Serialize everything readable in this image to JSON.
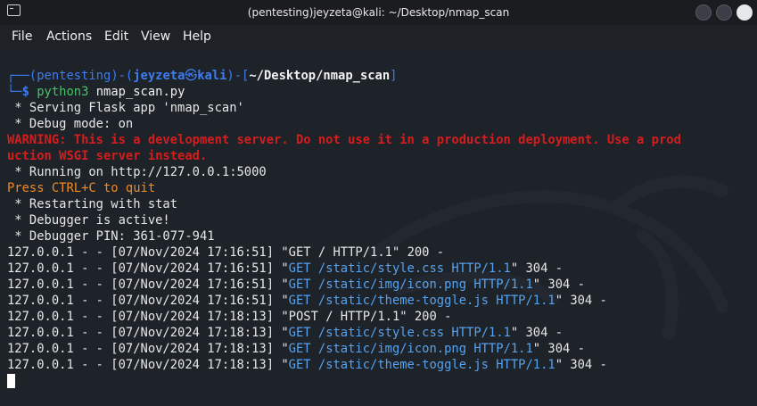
{
  "window": {
    "title": "(pentesting)jeyzeta@kali: ~/Desktop/nmap_scan"
  },
  "menu": [
    "File",
    "Actions",
    "Edit",
    "View",
    "Help"
  ],
  "prompt": {
    "top_open": "┌──(",
    "env": "pentesting",
    "mid": ")-(",
    "user": "jeyzeta",
    "at_icon": "㉿",
    "host": "kali",
    "close_bracket": ")-[",
    "path": "~/Desktop/nmap_scan",
    "end_bracket": "]",
    "bottom": "└─",
    "dollar": "$ ",
    "cmd_name": "python3",
    "cmd_arg": " nmap_scan.py"
  },
  "output": {
    "serving": " * Serving Flask app 'nmap_scan'",
    "debug_mode": " * Debug mode: on",
    "warning_1": "WARNING: This is a development server. Do not use it in a production deployment. Use a prod",
    "warning_2": "uction WSGI server instead.",
    "running": " * Running on http://127.0.0.1:5000",
    "quit": "Press CTRL+C to quit",
    "restarting": " * Restarting with stat",
    "debugger_active": " * Debugger is active!",
    "debugger_pin": " * Debugger PIN: 361-077-941"
  },
  "requests": [
    {
      "prefix": "127.0.0.1 - - [07/Nov/2024 17:16:51] \"",
      "req": "GET / HTTP/1.1",
      "req_colored": false,
      "suffix": "\" 200 -"
    },
    {
      "prefix": "127.0.0.1 - - [07/Nov/2024 17:16:51] \"",
      "req": "GET /static/style.css HTTP/1.1",
      "req_colored": true,
      "suffix": "\" 304 -"
    },
    {
      "prefix": "127.0.0.1 - - [07/Nov/2024 17:16:51] \"",
      "req": "GET /static/img/icon.png HTTP/1.1",
      "req_colored": true,
      "suffix": "\" 304 -"
    },
    {
      "prefix": "127.0.0.1 - - [07/Nov/2024 17:16:51] \"",
      "req": "GET /static/theme-toggle.js HTTP/1.1",
      "req_colored": true,
      "suffix": "\" 304 -"
    },
    {
      "prefix": "127.0.0.1 - - [07/Nov/2024 17:18:13] \"",
      "req": "POST / HTTP/1.1",
      "req_colored": false,
      "suffix": "\" 200 -"
    },
    {
      "prefix": "127.0.0.1 - - [07/Nov/2024 17:18:13] \"",
      "req": "GET /static/style.css HTTP/1.1",
      "req_colored": true,
      "suffix": "\" 304 -"
    },
    {
      "prefix": "127.0.0.1 - - [07/Nov/2024 17:18:13] \"",
      "req": "GET /static/img/icon.png HTTP/1.1",
      "req_colored": true,
      "suffix": "\" 304 -"
    },
    {
      "prefix": "127.0.0.1 - - [07/Nov/2024 17:18:13] \"",
      "req": "GET /static/theme-toggle.js HTTP/1.1",
      "req_colored": true,
      "suffix": "\" 304 -"
    }
  ],
  "colors": {
    "prompt_frame": "#3c7cf0",
    "prompt_path_green": "#45c46a",
    "warning": "#d51d1d",
    "quit": "#f08a24",
    "request_highlight": "#55a3f0"
  }
}
